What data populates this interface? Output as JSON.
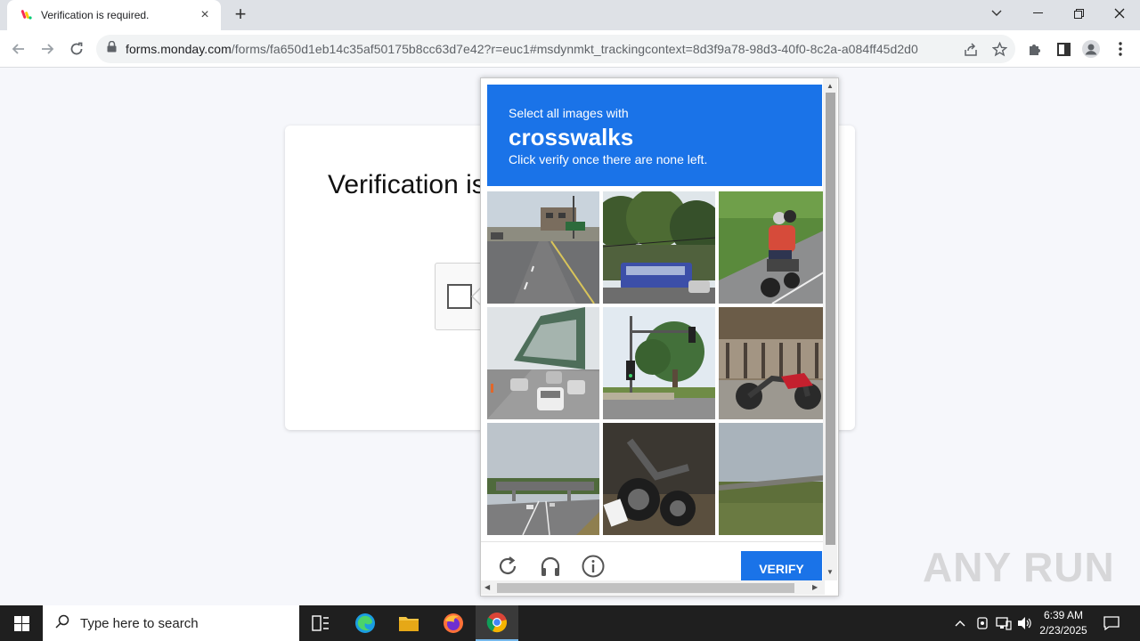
{
  "browser": {
    "tab_title": "Verification is required.",
    "url_host": "forms.monday.com",
    "url_path": "/forms/fa650d1eb14c35af50175b8cc63d7e42?r=euc1#msdynmkt_trackingcontext=8d3f9a78-98d3-40f0-8c2a-a084ff45d2d0"
  },
  "page": {
    "title": "Verification is required."
  },
  "challenge": {
    "subtitle": "Select all images with",
    "target": "crosswalks",
    "hint": "Click verify once there are none left.",
    "verify_label": "VERIFY",
    "tiles": [
      "highway-with-signs",
      "bus-under-trees",
      "motorcyclist-on-road",
      "bridge-traffic",
      "traffic-light-tree",
      "parked-motorcycle",
      "overpass-highway",
      "toppled-motorcycle",
      "grass-overpass"
    ],
    "accent_color": "#1a73e8"
  },
  "watermark": "ANY RUN",
  "taskbar": {
    "search_placeholder": "Type here to search",
    "time": "6:39 AM",
    "date": "2/23/2025"
  }
}
